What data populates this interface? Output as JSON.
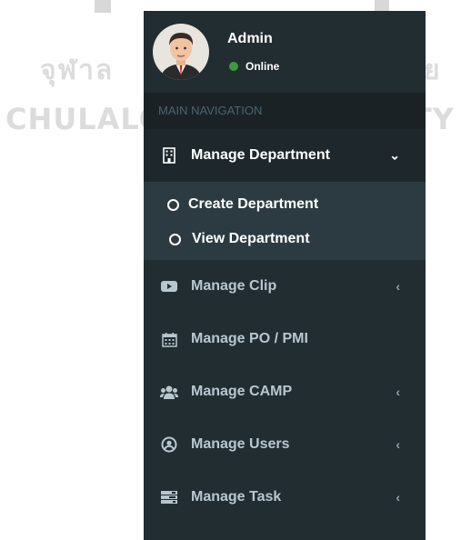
{
  "background": {
    "thai_left": "จุฬาล",
    "thai_right": "ย",
    "en_left": "CHULALO",
    "en_right": "ITY"
  },
  "user": {
    "name": "Admin",
    "status": "Online"
  },
  "nav": {
    "header": "MAIN NAVIGATION",
    "items": [
      {
        "label": "Manage Department",
        "icon": "building-icon",
        "chevron": "⌄",
        "active": true,
        "children": [
          {
            "label": "Create Department"
          },
          {
            "label": "View Department"
          }
        ]
      },
      {
        "label": "Manage Clip",
        "icon": "youtube-icon",
        "chevron": "‹"
      },
      {
        "label": "Manage PO / PMI",
        "icon": "calendar-icon",
        "chevron": ""
      },
      {
        "label": "Manage CAMP",
        "icon": "users-icon",
        "chevron": "‹"
      },
      {
        "label": "Manage Users",
        "icon": "user-circle-icon",
        "chevron": "‹"
      },
      {
        "label": "Manage Task",
        "icon": "task-icon",
        "chevron": "‹"
      }
    ]
  },
  "colors": {
    "sidebar_bg": "#222d32",
    "active_bg": "#1e282c",
    "submenu_bg": "#2c3b41",
    "status_online": "#3c9a3c"
  }
}
